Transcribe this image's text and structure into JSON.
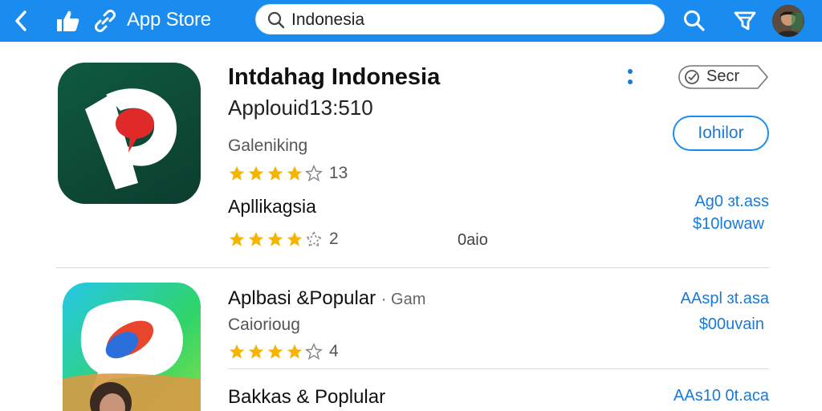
{
  "header": {
    "title": "App Store",
    "search_value": "Indonesia",
    "icons": [
      "back-icon",
      "thumbs-up-icon",
      "link-icon",
      "search-icon",
      "filter-icon",
      "avatar"
    ],
    "accent_color": "#1a8cf0"
  },
  "apps": [
    {
      "name": "Intdahag Indonesia",
      "subtitle": "Applouid13:510",
      "category": "Galeniking",
      "rating_count": "13",
      "developer": "Apllikagsia",
      "rating_count_2": "2",
      "misc": "0aio",
      "secondary_action": "Secr",
      "install_label": "Iohilor",
      "price_line_1": "Ag0 ɜt.ass",
      "price_line_2": "$10lowaw"
    },
    {
      "name": "Aplbasi &Popular",
      "name_suffix": "· Gam",
      "category": "Caiorioug",
      "rating_count": "4",
      "price_line_1": "AAspl ɜt.asa",
      "price_line_2": "$00uvain"
    },
    {
      "name": "Bakkas & Poplular",
      "price_line_1": "AAs10 0t.aca"
    }
  ]
}
